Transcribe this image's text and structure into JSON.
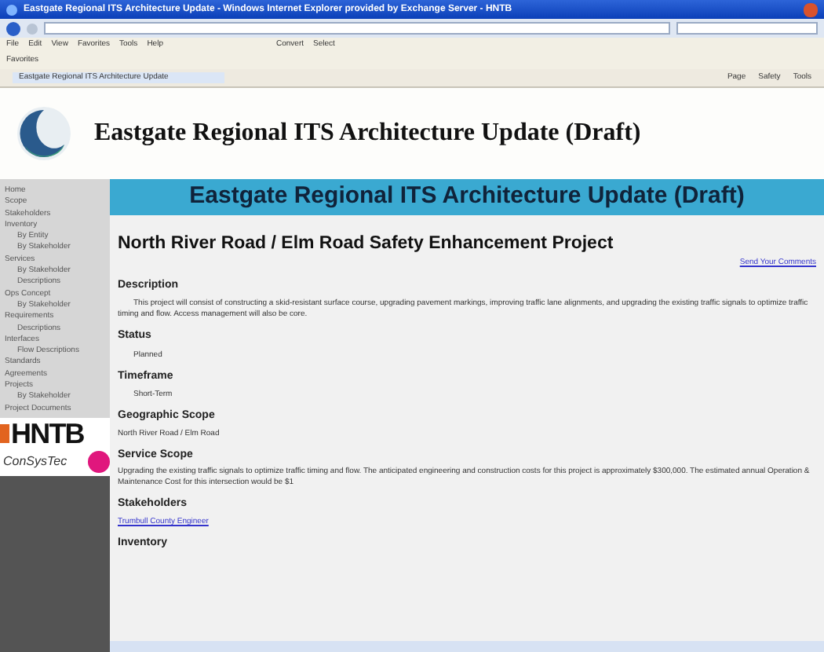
{
  "window": {
    "title": "Eastgate Regional ITS Architecture Update - Windows Internet Explorer provided by Exchange Server - HNTB"
  },
  "menu": [
    "File",
    "Edit",
    "View",
    "Favorites",
    "Tools",
    "Help"
  ],
  "toolbar": {
    "convert": "Convert",
    "select": "Select",
    "favorites": "Favorites"
  },
  "tab": {
    "label": "Eastgate Regional ITS Architecture Update"
  },
  "command_bar": [
    "Page",
    "Safety",
    "Tools"
  ],
  "site": {
    "title": "Eastgate Regional ITS Architecture Update (Draft)",
    "banner": "Eastgate Regional ITS Architecture Update (Draft)"
  },
  "sidebar": {
    "items": [
      {
        "label": "Home"
      },
      {
        "label": "Scope"
      },
      {
        "label": "Stakeholders"
      },
      {
        "label": "Inventory",
        "children": [
          {
            "label": "By Entity"
          },
          {
            "label": "By Stakeholder"
          }
        ]
      },
      {
        "label": "Services",
        "children": [
          {
            "label": "By Stakeholder"
          },
          {
            "label": "Descriptions"
          }
        ]
      },
      {
        "label": "Ops Concept",
        "children": [
          {
            "label": "By Stakeholder"
          }
        ]
      },
      {
        "label": "Requirements",
        "children": [
          {
            "label": "Descriptions"
          }
        ]
      },
      {
        "label": "Interfaces",
        "children": [
          {
            "label": "Flow Descriptions"
          }
        ]
      },
      {
        "label": "Standards"
      },
      {
        "label": "Agreements"
      },
      {
        "label": "Projects",
        "children": [
          {
            "label": "By Stakeholder"
          }
        ]
      },
      {
        "label": "Project Documents"
      }
    ],
    "logos": [
      "HNTB",
      "ConSysTec"
    ]
  },
  "project": {
    "title": "North River Road / Elm Road Safety Enhancement Project",
    "comment_link": "Send Your Comments",
    "sections": [
      {
        "heading": "Description",
        "kind": "indented",
        "text": "This project will consist of constructing a skid-resistant surface course, upgrading pavement markings, improving traffic lane alignments, and upgrading the existing traffic signals to optimize traffic timing and flow. Access management will also be core."
      },
      {
        "heading": "Status",
        "kind": "indented",
        "text": "Planned"
      },
      {
        "heading": "Timeframe",
        "kind": "indented",
        "text": "Short-Term"
      },
      {
        "heading": "Geographic Scope",
        "kind": "plain",
        "text": "North River Road / Elm Road"
      },
      {
        "heading": "Service Scope",
        "kind": "plain",
        "text": "Upgrading the existing traffic signals to optimize traffic timing and flow. The anticipated engineering and construction costs for this project is approximately $300,000. The estimated annual Operation & Maintenance Cost for this intersection would be $1"
      },
      {
        "heading": "Stakeholders",
        "kind": "link",
        "text": "Trumbull County Engineer"
      },
      {
        "heading": "Inventory",
        "kind": "none"
      }
    ]
  }
}
